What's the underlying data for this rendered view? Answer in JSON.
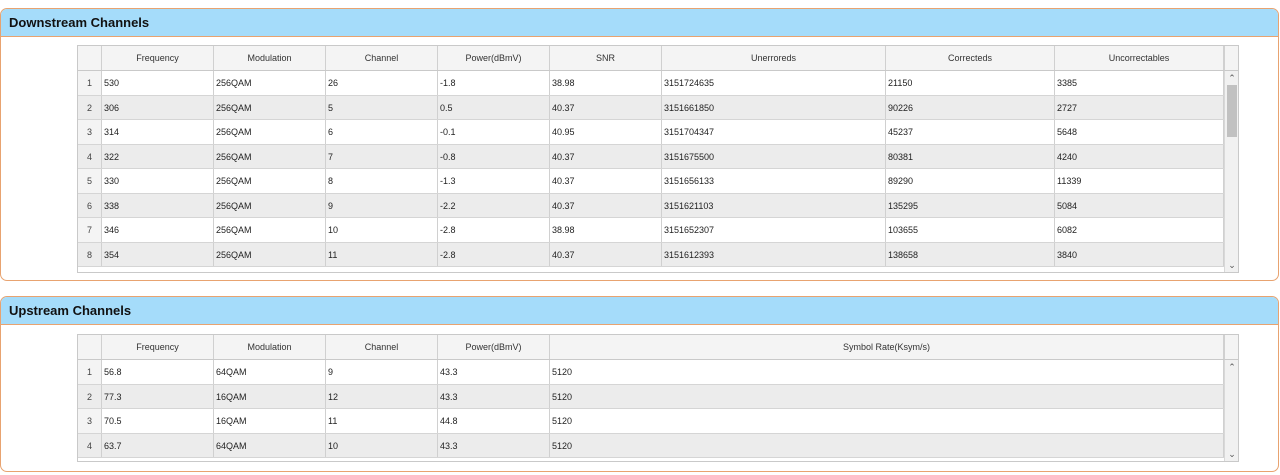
{
  "downstream": {
    "title": "Downstream Channels",
    "columns": [
      "Frequency",
      "Modulation",
      "Channel",
      "Power(dBmV)",
      "SNR",
      "Unerroreds",
      "Correcteds",
      "Uncorrectables"
    ],
    "rows": [
      [
        "1",
        "530",
        "256QAM",
        "26",
        "-1.8",
        "38.98",
        "3151724635",
        "21150",
        "3385"
      ],
      [
        "2",
        "306",
        "256QAM",
        "5",
        "0.5",
        "40.37",
        "3151661850",
        "90226",
        "2727"
      ],
      [
        "3",
        "314",
        "256QAM",
        "6",
        "-0.1",
        "40.95",
        "3151704347",
        "45237",
        "5648"
      ],
      [
        "4",
        "322",
        "256QAM",
        "7",
        "-0.8",
        "40.37",
        "3151675500",
        "80381",
        "4240"
      ],
      [
        "5",
        "330",
        "256QAM",
        "8",
        "-1.3",
        "40.37",
        "3151656133",
        "89290",
        "11339"
      ],
      [
        "6",
        "338",
        "256QAM",
        "9",
        "-2.2",
        "40.37",
        "3151621103",
        "135295",
        "5084"
      ],
      [
        "7",
        "346",
        "256QAM",
        "10",
        "-2.8",
        "38.98",
        "3151652307",
        "103655",
        "6082"
      ],
      [
        "8",
        "354",
        "256QAM",
        "11",
        "-2.8",
        "40.37",
        "3151612393",
        "138658",
        "3840"
      ]
    ]
  },
  "upstream": {
    "title": "Upstream Channels",
    "columns": [
      "Frequency",
      "Modulation",
      "Channel",
      "Power(dBmV)",
      "Symbol Rate(Ksym/s)"
    ],
    "rows": [
      [
        "1",
        "56.8",
        "64QAM",
        "9",
        "43.3",
        "5120"
      ],
      [
        "2",
        "77.3",
        "16QAM",
        "12",
        "43.3",
        "5120"
      ],
      [
        "3",
        "70.5",
        "16QAM",
        "11",
        "44.8",
        "5120"
      ],
      [
        "4",
        "63.7",
        "64QAM",
        "10",
        "43.3",
        "5120"
      ]
    ]
  },
  "scroll_icons": {
    "up": "chevron-up-icon",
    "down": "chevron-down-icon"
  }
}
